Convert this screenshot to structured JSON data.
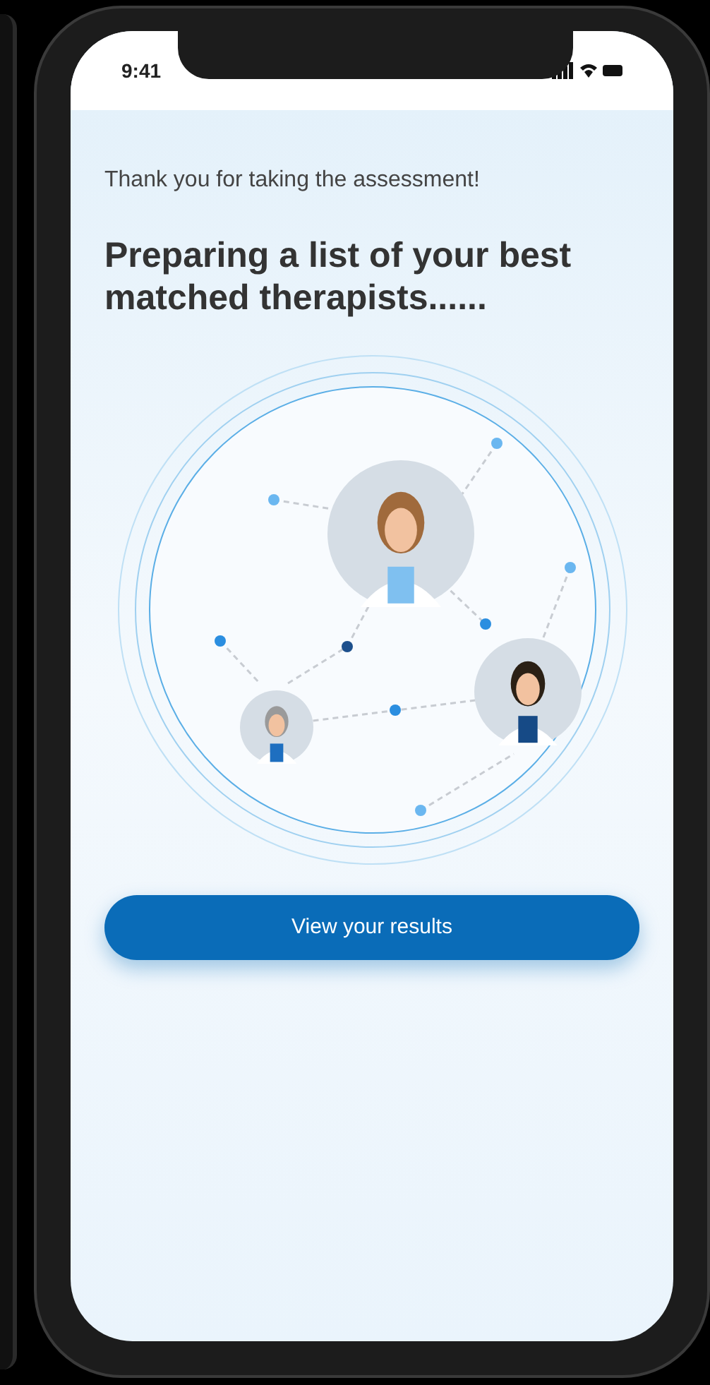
{
  "status_bar": {
    "time": "9:41"
  },
  "intro": "Thank you for taking the assessment!",
  "heading": "Preparing a list of your best matched therapists......",
  "button": {
    "label": "View your results"
  }
}
